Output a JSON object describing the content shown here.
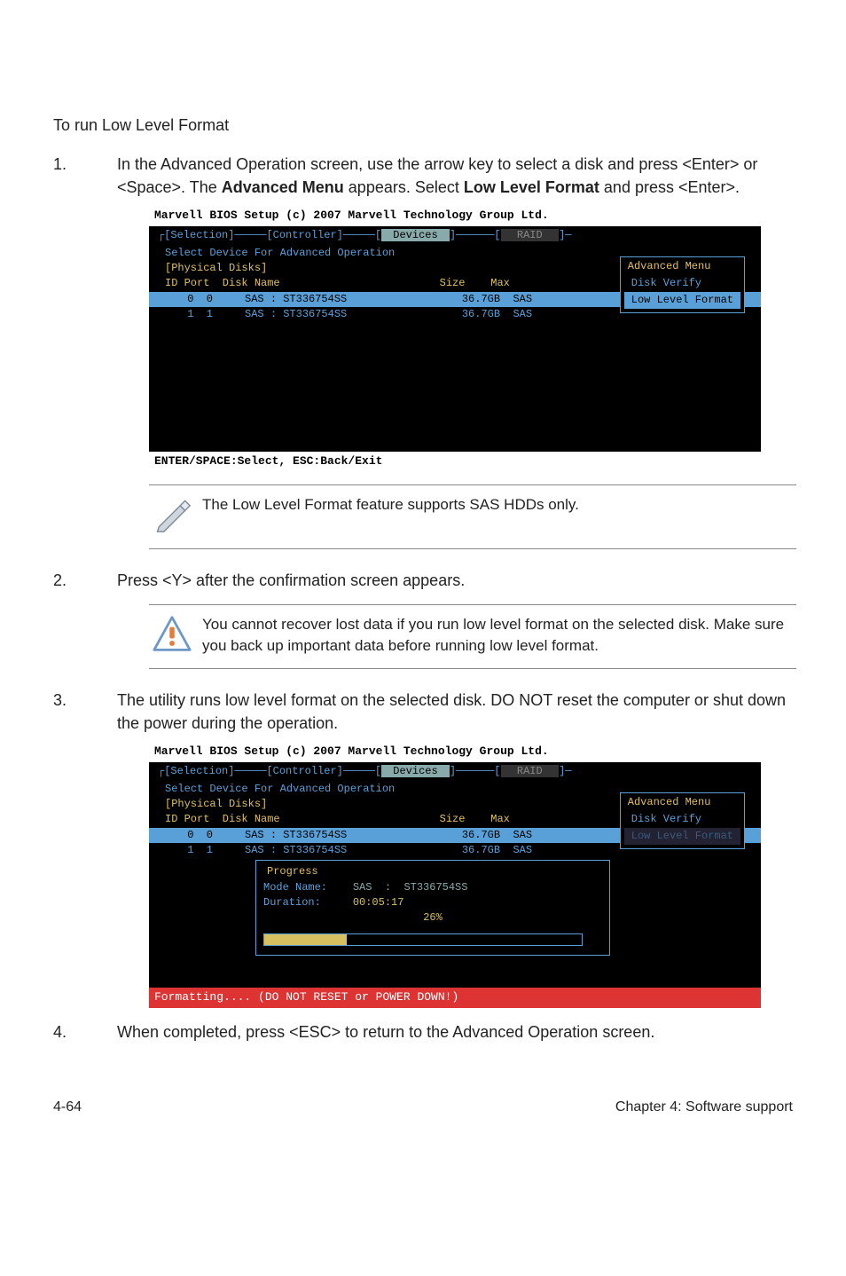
{
  "title": "To run Low Level Format",
  "steps": {
    "s1_num": "1.",
    "s1_text_a": "In the Advanced Operation screen, use the arrow key to select a disk and press <Enter> or <Space>. The ",
    "s1_bold_a": "Advanced Menu",
    "s1_text_b": " appears. Select ",
    "s1_bold_b": "Low Level Format",
    "s1_text_c": " and press <Enter>.",
    "s2_num": "2.",
    "s2_text": "Press <Y> after the confirmation screen appears.",
    "s3_num": "3.",
    "s3_text": "The utility runs low level format on the selected disk. DO NOT reset the computer or shut down the power during the operation.",
    "s4_num": "4.",
    "s4_text": "When completed, press <ESC> to return to the Advanced Operation screen."
  },
  "note": "The Low Level Format feature supports SAS HDDs only.",
  "warning": "You cannot recover lost data if you run low level format on the selected disk. Make sure you back up important data before running low level format.",
  "term_header": "Marvell BIOS Setup (c) 2007 Marvell Technology Group Ltd.",
  "term_tabs_a": "[Selection]",
  "term_tabs_b": "[Controller]",
  "term_tabs_c": " Devices ",
  "term_tabs_d": "  RAID  ",
  "term_subtitle": "Select Device For Advanced Operation",
  "term_physdisks": "[Physical Disks]",
  "term_colhead": "ID Port  Disk Name                         Size    Max",
  "term_row0": " 0  0     SAS : ST336754SS                  36.7GB  SAS ",
  "term_row1": " 1  1     SAS : ST336754SS                  36.7GB  SAS ",
  "term_footer1": "ENTER/SPACE:Select, ESC:Back/Exit",
  "term_footer2": "Formatting.... (DO NOT RESET or POWER DOWN!)",
  "adv_menu_title": "Advanced Menu",
  "adv_menu_item1": "Disk Verify     ",
  "adv_menu_item2": "Low Level Format",
  "progress_title": "Progress",
  "progress_mode_label": "Mode Name:    ",
  "progress_mode_value": "SAS  :  ST336754SS",
  "progress_dur_label": "Duration:     ",
  "progress_dur_value": "00:05:17",
  "progress_percent": "26%",
  "footer_left": "4-64",
  "footer_right": "Chapter 4: Software support"
}
